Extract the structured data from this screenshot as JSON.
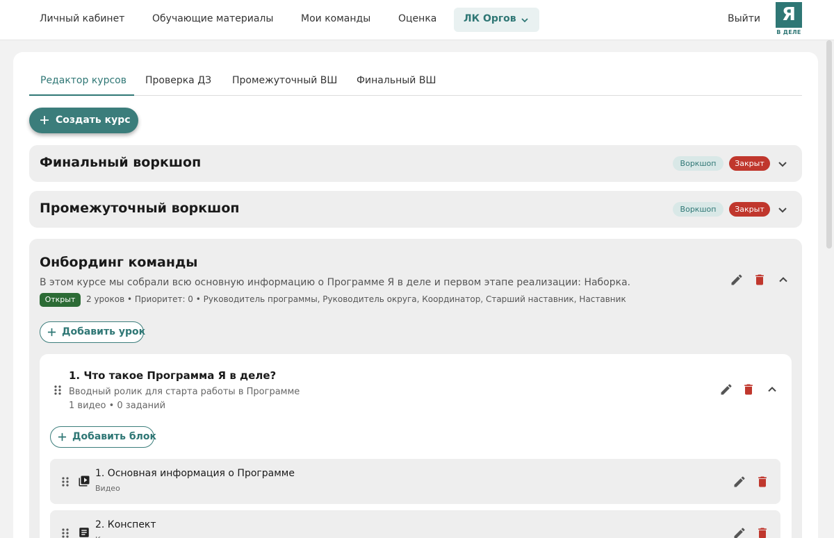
{
  "colors": {
    "accent": "#2f7775",
    "danger": "#c0372d",
    "open": "#2c6b35"
  },
  "nav": {
    "items": [
      "Личный кабинет",
      "Обучающие материалы",
      "Мои команды",
      "Оценка"
    ],
    "active": "ЛК Оргов",
    "logout": "Выйти",
    "logo": {
      "letter": "Я",
      "text": "В ДЕЛЕ"
    }
  },
  "tabs": [
    "Редактор курсов",
    "Проверка ДЗ",
    "Промежуточный ВШ",
    "Финальный ВШ"
  ],
  "create_button": "Создать курс",
  "collapsed_courses": [
    {
      "title": "Финальный воркшоп",
      "type": "Воркшоп",
      "status": "Закрыт"
    },
    {
      "title": "Промежуточный воркшоп",
      "type": "Воркшоп",
      "status": "Закрыт"
    }
  ],
  "open_course": {
    "title": "Онбординг команды",
    "description": "В этом курсе мы собрали всю основную информацию о Программе Я в деле и первом этапе реализации: Наборка.",
    "status": "Открыт",
    "meta": "2 уроков • Приоритет: 0  • Руководитель программы, Руководитель округа, Координатор, Старший наставник, Наставник",
    "add_lesson": "Добавить урок",
    "lesson": {
      "title": "1. Что такое Программа Я в деле?",
      "description": "Вводный ролик для старта работы в Программе",
      "meta": "1 видео • 0 заданий",
      "add_block": "Добавить блок",
      "blocks": [
        {
          "name": "1. Основная информация о Программе",
          "kind": "Видео",
          "icon": "video-icon"
        },
        {
          "name": "2. Конспект",
          "kind": "Конспект",
          "icon": "document-icon"
        }
      ]
    }
  }
}
